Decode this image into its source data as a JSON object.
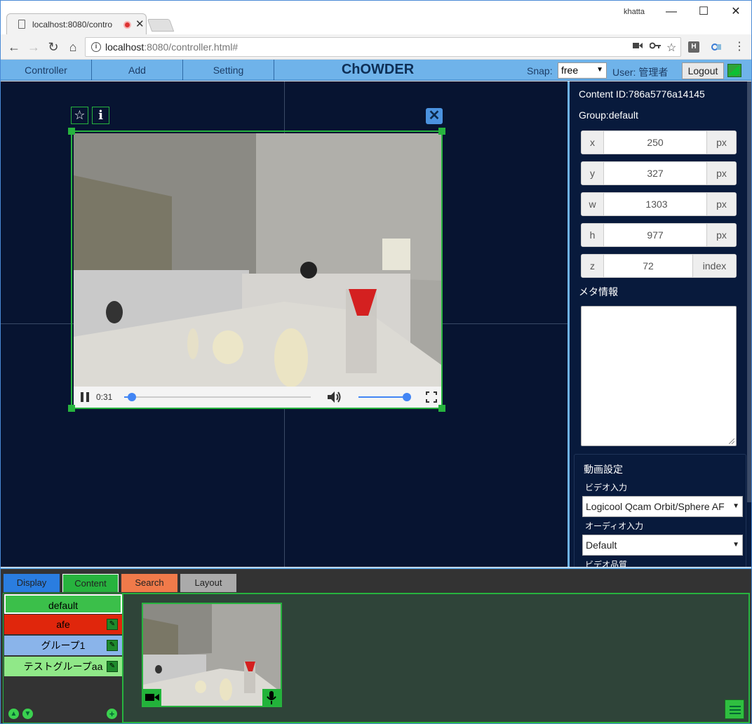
{
  "browser": {
    "tab_title": "localhost:8080/contro",
    "username": "khatta",
    "url_host": "localhost",
    "url_rest": ":8080/controller.html#",
    "ext_h": "H"
  },
  "appbar": {
    "menu": [
      "Controller",
      "Add",
      "Setting"
    ],
    "title": "ChOWDER",
    "snap_label": "Snap:",
    "snap_value": "free",
    "user_label": "User: 管理者",
    "logout": "Logout"
  },
  "video": {
    "time": "0:31",
    "progress": 0.02,
    "volume": 0.95
  },
  "panel": {
    "content_id": "Content ID:786a5776a14145",
    "group": "Group:default",
    "fields": [
      {
        "label": "x",
        "value": "250",
        "unit": "px"
      },
      {
        "label": "y",
        "value": "327",
        "unit": "px"
      },
      {
        "label": "w",
        "value": "1303",
        "unit": "px"
      },
      {
        "label": "h",
        "value": "977",
        "unit": "px"
      },
      {
        "label": "z",
        "value": "72",
        "unit": "index"
      }
    ],
    "meta_label": "メタ情報",
    "video_settings": {
      "title": "動画設定",
      "video_input_label": "ビデオ入力",
      "video_input_value": "Logicool Qcam Orbit/Sphere AF",
      "audio_input_label": "オーディオ入力",
      "audio_input_value": "Default",
      "quality_label": "ビデオ品質"
    }
  },
  "bottom": {
    "tabs": [
      {
        "label": "Display",
        "color": "#2a7de0"
      },
      {
        "label": "Content",
        "color": "#27b33e"
      },
      {
        "label": "Search",
        "color": "#f07a4a"
      },
      {
        "label": "Layout",
        "color": "#aaaaaa"
      }
    ],
    "groups": [
      {
        "label": "default",
        "color": "#3bbf4a"
      },
      {
        "label": "afe",
        "color": "#e0260c"
      },
      {
        "label": "グループ1",
        "color": "#8ab4ea"
      },
      {
        "label": "テストグループaa",
        "color": "#90e888"
      }
    ]
  }
}
